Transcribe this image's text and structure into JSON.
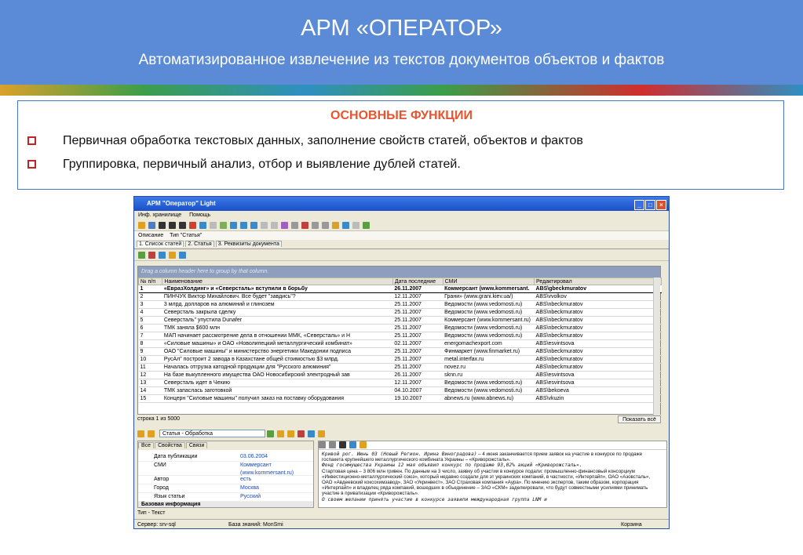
{
  "slide": {
    "title": "АРМ «ОПЕРАТОР»",
    "subtitle": "Автоматизированное извлечение из текстов документов объектов и фактов"
  },
  "functions": {
    "heading": "ОСНОВНЫЕ ФУНКЦИИ",
    "items": [
      "Первичная обработка текстовых данных, заполнение свойств статей, объектов и фактов",
      "Группировка, первичный анализ, отбор и выявление дублей статей."
    ]
  },
  "window": {
    "title": "АРМ \"Оператор\" Light",
    "menu": [
      "Инф. хранилище",
      "Помощь"
    ],
    "desc_tabs": [
      "Описание",
      "Тип \"Статья\""
    ],
    "tabs": [
      "1. Список статей",
      "2. Статья",
      "3. Реквизиты документа"
    ],
    "group_hint": "Drag a column header here to group by that column.",
    "columns": [
      "№ п/п",
      "Наименование",
      "Дата последние",
      "СМИ",
      "Редактировал"
    ],
    "rows": [
      [
        "1",
        "«ЕвразХолдинг» и «Северсталь» вступили в борьбу",
        "26.11.2007",
        "Коммерсант (www.kommersant.",
        "ABS\\gbeckmuratov"
      ],
      [
        "2",
        "ПИНЧУК Виктор Михайлович. Все будет \"завдись\"?",
        "12.11.2007",
        "Грани» (www.grani.kiev.ua/)",
        "ABS\\vvolkov"
      ],
      [
        "3",
        "3 млрд. долларов на алюминий и глинозем",
        "25.11.2007",
        "Ведомости (www.vedomosti.ru)",
        "ABS\\nbeckmuratov"
      ],
      [
        "4",
        "Северсталь закрыла сделку",
        "25.11.2007",
        "Ведомости (www.vedomosti.ru)",
        "ABS\\nbeckmuratov"
      ],
      [
        "5",
        "Северсталь\" упустила Dunafer",
        "25.11.2007",
        "Коммерсант (www.kommersant.ru)",
        "ABS\\nbeckmuratov"
      ],
      [
        "6",
        "ТМК заняла $600 млн",
        "25.11.2007",
        "Ведомости (www.vedomosti.ru)",
        "ABS\\nbeckmuratov"
      ],
      [
        "7",
        "МАП начинает рассмотрение дела в отношении ММК, «Северсталь» и Н",
        "25.11.2007",
        "Ведомости (www.vedomosti.ru)",
        "ABS\\nbeckmuratov"
      ],
      [
        "8",
        "«Силовые машины» и ОАО «Новолипецкий металлургический комбинат»",
        "02.11.2007",
        "energomachexport.com",
        "ABS\\esvintsova"
      ],
      [
        "9",
        "ОАО \"Силовые машины\" и министерство энергетики Македонии подписа",
        "25.11.2007",
        "Финмаркет (www.finmarket.ru)",
        "ABS\\nbeckmuratov"
      ],
      [
        "10",
        "РусАл\" построит 2 завода в Казахстане общей стоимостью $3 млрд.",
        "25.11.2007",
        "metal.interfax.ru",
        "ABS\\nbeckmuratov"
      ],
      [
        "11",
        "Началась отгрузка катодной продукции для \"Русского алюминия\"",
        "25.11.2007",
        "novez.ru",
        "ABS\\nbeckmuratov"
      ],
      [
        "12",
        "На базе выкупленного имущества ОАО Новосибирский электродный зав",
        "26.11.2007",
        "sknn.ru",
        "ABS\\esvintsova"
      ],
      [
        "13",
        "Северсталь идет в Чехию",
        "12.11.2007",
        "Ведомости (www.vedomosti.ru)",
        "ABS\\esvintsova"
      ],
      [
        "14",
        "ТМК запаслась заготовкой",
        "04.10.2007",
        "Ведомости (www.vedomosti.ru)",
        "ABS\\bekoeva"
      ],
      [
        "15",
        "Концерн \"Силовые машины\" получил заказ на поставку оборудования",
        "19.10.2007",
        "abnews.ru (www.abnews.ru)",
        "ABS\\vkuzin"
      ]
    ],
    "status": "строка 1 из 5000",
    "show_all": "Показать всё",
    "combo": "Статья - Обработка",
    "prop_tabs": [
      "Все",
      "Свойства",
      "Связи"
    ],
    "props": [
      [
        "Дата публикации",
        "03.06.2004"
      ],
      [
        "СМИ",
        "Коммерсант (www.kommersant.ru)"
      ],
      [
        "Автор",
        "есть"
      ],
      [
        "Город",
        "Москва"
      ],
      [
        "Язык статьи",
        "Русский"
      ]
    ],
    "base_info": "Базовая информация",
    "text_line1": "Кривой рог. Июнь 03 (Новый Регион. Ирина Виноградова)",
    "text_line2": "– 4 июня заканчивается прием заявок на участие в конкурсе по продаже госпакета крупнейшего металлургического комбината Украины – «Криворожсталь».",
    "text_line3": "Фонд госимущества Украины 12 мая объявил конкурс по продаже 93,02% акций «Криворожсталь».",
    "text_line4": "Стартовая цена – 3 806 млн гривен. По данным на 3 число, заявку об участии в конкурсе подали: промышленно-финансовый консорциум «Инвестиционно-металлургический союз», который недавно создали для эт украинских компаний, в частности, «Интерпайп», ОАО «Азовсталь», ОАО «Авдеевский коксохимзавод», ЗАО «Укринвест», ЗАО Страховая компания «Аура». По мнению экспертов, таким образом, корпорация «Интерпайп» и владелец ряда компаний, вошедших в объединение – ЗАО «СКМ» заделкировали, что будут совместными усилиями принимать участие в приватизации «Криворожсталь».",
    "text_line5": "О своем желании принять участие в конкурсе заявили международная группа LNM и",
    "type_bar": "Тип - Текст",
    "server": "Сервер: srv-sql",
    "kb": "База знаний: MonSmi",
    "basket": "Корзина"
  }
}
